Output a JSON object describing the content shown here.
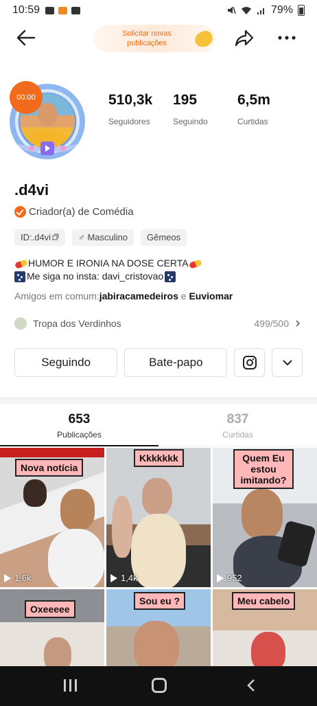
{
  "status_bar": {
    "time": "10:59",
    "battery": "79%"
  },
  "header": {
    "request_label": "Solicitar novas publicações"
  },
  "profile": {
    "live_badge": "00:00",
    "stats": [
      {
        "value": "510,3k",
        "label": "Seguidores"
      },
      {
        "value": "195",
        "label": "Seguindo"
      },
      {
        "value": "6,5m",
        "label": "Curtidas"
      }
    ],
    "username": ".d4vi",
    "creator_label": "Criador(a) de Comédia",
    "tags": {
      "id": "ID:.d4vi",
      "gender": "Masculino",
      "sign": "Gêmeos"
    },
    "bio_line1": "HUMOR E IRONIA NA DOSE CERTA",
    "bio_line2": "Me siga no insta: davi_cristovao",
    "friends_prefix": "Amigos em comum:",
    "friend1": "jabiracamedeiros",
    "friends_and": " e ",
    "friend2": "Euviomar",
    "group_name": "Tropa dos Verdinhos",
    "group_count": "499/500"
  },
  "buttons": {
    "following": "Seguindo",
    "chat": "Bate-papo"
  },
  "tabs": [
    {
      "count": "653",
      "label": "Publicações"
    },
    {
      "count": "837",
      "label": "Curtidas"
    }
  ],
  "posts": [
    {
      "caption": "Nova notícia",
      "views": "1,6k"
    },
    {
      "caption": "Kkkkkkk",
      "views": "1,4k"
    },
    {
      "caption": "Quem Eu estou imitando?",
      "views": "952"
    },
    {
      "caption": "Oxeeeee",
      "views": ""
    },
    {
      "caption": "Sou eu ?",
      "views": ""
    },
    {
      "caption": "Meu cabelo",
      "views": ""
    }
  ],
  "colors": {
    "accent": "#f26b1d",
    "caption_bg": "#ffb7b7"
  }
}
